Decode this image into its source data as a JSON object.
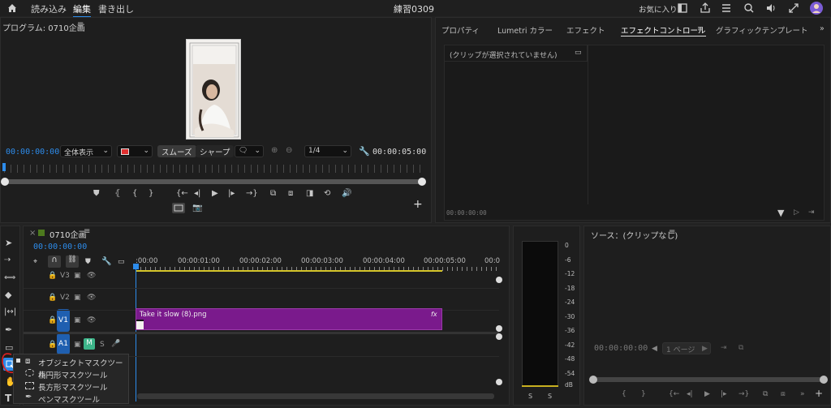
{
  "topbar": {
    "home_icon": "home-icon",
    "tabs": [
      "読み込み",
      "編集",
      "書き出し"
    ],
    "active_tab": "編集",
    "project_title": "練習0309",
    "favorites": "お気に入り"
  },
  "program": {
    "title": "プログラム: 0710企画",
    "timecode_in": "00:00:00:00",
    "fit": "全体表示",
    "smooth": "スムーズ",
    "sharp": "シャープ",
    "resolution": "1/4",
    "timecode_out": "00:00:05:00"
  },
  "effects": {
    "tabs": [
      "プロパティ",
      "Lumetri カラー",
      "エフェクト",
      "エフェクトコントロール",
      "グラフィックテンプレート"
    ],
    "active_tab": "エフェクトコントロール",
    "no_clip": "(クリップが選択されていません)",
    "timecode": "00:00:00:00"
  },
  "timeline": {
    "sequence_name": "0710企画",
    "timecode": "00:00:00:00",
    "ruler": [
      ":00:00",
      "00:00:01:00",
      "00:00:02:00",
      "00:00:03:00",
      "00:00:04:00",
      "00:00:05:00",
      "00:0"
    ],
    "tracks": [
      "V3",
      "V2",
      "V1",
      "A1"
    ],
    "clip_name": "Take it slow (8).png",
    "clip_fx": "fx",
    "mute": "M",
    "solo": "S"
  },
  "meter": {
    "scale": [
      "0",
      "-6",
      "-12",
      "-18",
      "-24",
      "-30",
      "-36",
      "-42",
      "-48",
      "-54",
      "dB"
    ],
    "channels": [
      "S",
      "S"
    ]
  },
  "source": {
    "title": "ソース：(クリップなし)",
    "timecode": "00:00:00:00",
    "page": "1 ページ"
  },
  "tool_menu": {
    "items": [
      "オブジェクトマスクツール",
      "楕円形マスクツール",
      "長方形マスクツール",
      "ペンマスクツール"
    ]
  },
  "colors": {
    "accent_blue": "#2d8ceb",
    "clip_purple": "#7a1a8c",
    "mute_green": "#3db58a",
    "annotation_red": "#e02020"
  }
}
